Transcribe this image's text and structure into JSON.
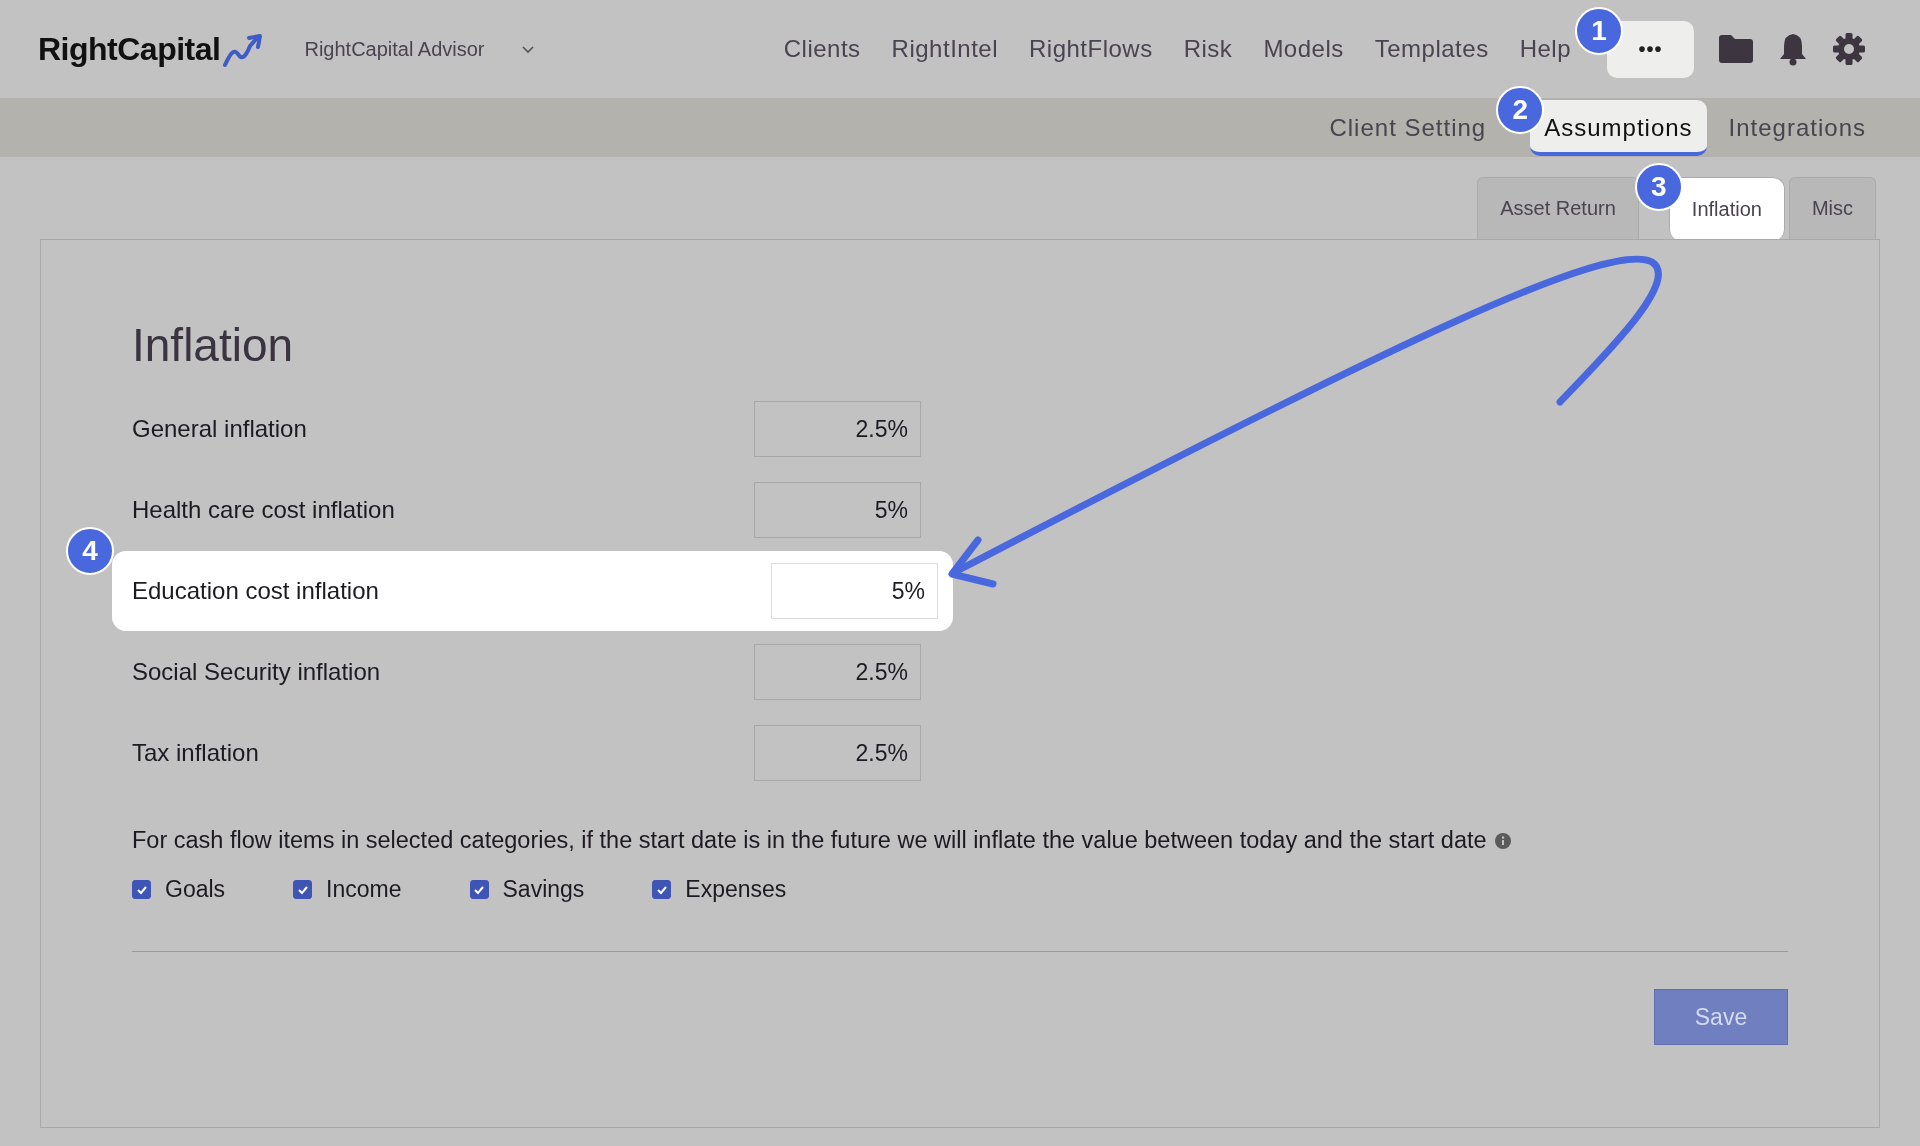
{
  "header": {
    "logo": "RightCapital",
    "account": "RightCapital Advisor",
    "nav": [
      {
        "label": "Clients"
      },
      {
        "label": "RightIntel"
      },
      {
        "label": "RightFlows"
      },
      {
        "label": "Risk"
      },
      {
        "label": "Models"
      },
      {
        "label": "Templates"
      },
      {
        "label": "Help"
      }
    ],
    "more_button": "•••"
  },
  "subnav": [
    {
      "label": "Client Setting",
      "selected": false
    },
    {
      "label": "Assumptions",
      "selected": true
    },
    {
      "label": "Integrations",
      "selected": false
    }
  ],
  "tabs": [
    {
      "label": "Asset Return",
      "selected": false
    },
    {
      "label": "Inflation",
      "selected": true
    },
    {
      "label": "Misc",
      "selected": false
    }
  ],
  "panel": {
    "title": "Inflation",
    "rows": [
      {
        "label": "General inflation",
        "value": "2.5%",
        "highlighted": false
      },
      {
        "label": "Health care cost inflation",
        "value": "5%",
        "highlighted": false
      },
      {
        "label": "Education cost inflation",
        "value": "5%",
        "highlighted": true
      },
      {
        "label": "Social Security inflation",
        "value": "2.5%",
        "highlighted": false
      },
      {
        "label": "Tax inflation",
        "value": "2.5%",
        "highlighted": false
      }
    ],
    "note": "For cash flow items in selected categories, if the start date is in the future we will inflate the value between today and the start date",
    "categories": [
      {
        "label": "Goals",
        "checked": true
      },
      {
        "label": "Income",
        "checked": true
      },
      {
        "label": "Savings",
        "checked": true
      },
      {
        "label": "Expenses",
        "checked": true
      }
    ],
    "save_button": "Save"
  },
  "step_badges": [
    "1",
    "2",
    "3",
    "4"
  ]
}
